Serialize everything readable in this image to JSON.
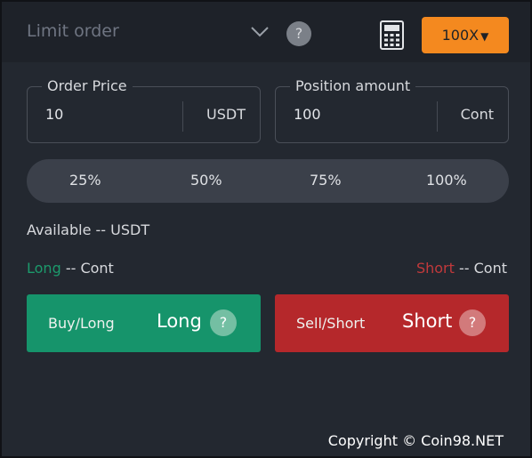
{
  "header": {
    "order_type": "Limit order",
    "help": "?",
    "leverage": "100X",
    "leverage_caret": "▼"
  },
  "order_price": {
    "label": "Order Price",
    "value": "10",
    "unit": "USDT"
  },
  "position_amount": {
    "label": "Position amount",
    "value": "100",
    "unit": "Cont"
  },
  "percent_options": [
    "25%",
    "50%",
    "75%",
    "100%"
  ],
  "available": {
    "label": "Available",
    "value": "-- USDT"
  },
  "long_info": {
    "label": "Long",
    "value": "-- Cont"
  },
  "short_info": {
    "label": "Short",
    "value": "-- Cont"
  },
  "buttons": {
    "buy": {
      "sub": "Buy/Long",
      "main": "Long",
      "help": "?"
    },
    "sell": {
      "sub": "Sell/Short",
      "main": "Short",
      "help": "?"
    }
  },
  "footer": {
    "copyright": "Copyright © Coin98.NET"
  },
  "colors": {
    "accent_orange": "#f4891f",
    "long_green": "#16946b",
    "short_red": "#b5282b",
    "panel_bg": "#232830"
  },
  "icons": [
    "chevron-down-icon",
    "help-icon",
    "calculator-icon"
  ]
}
